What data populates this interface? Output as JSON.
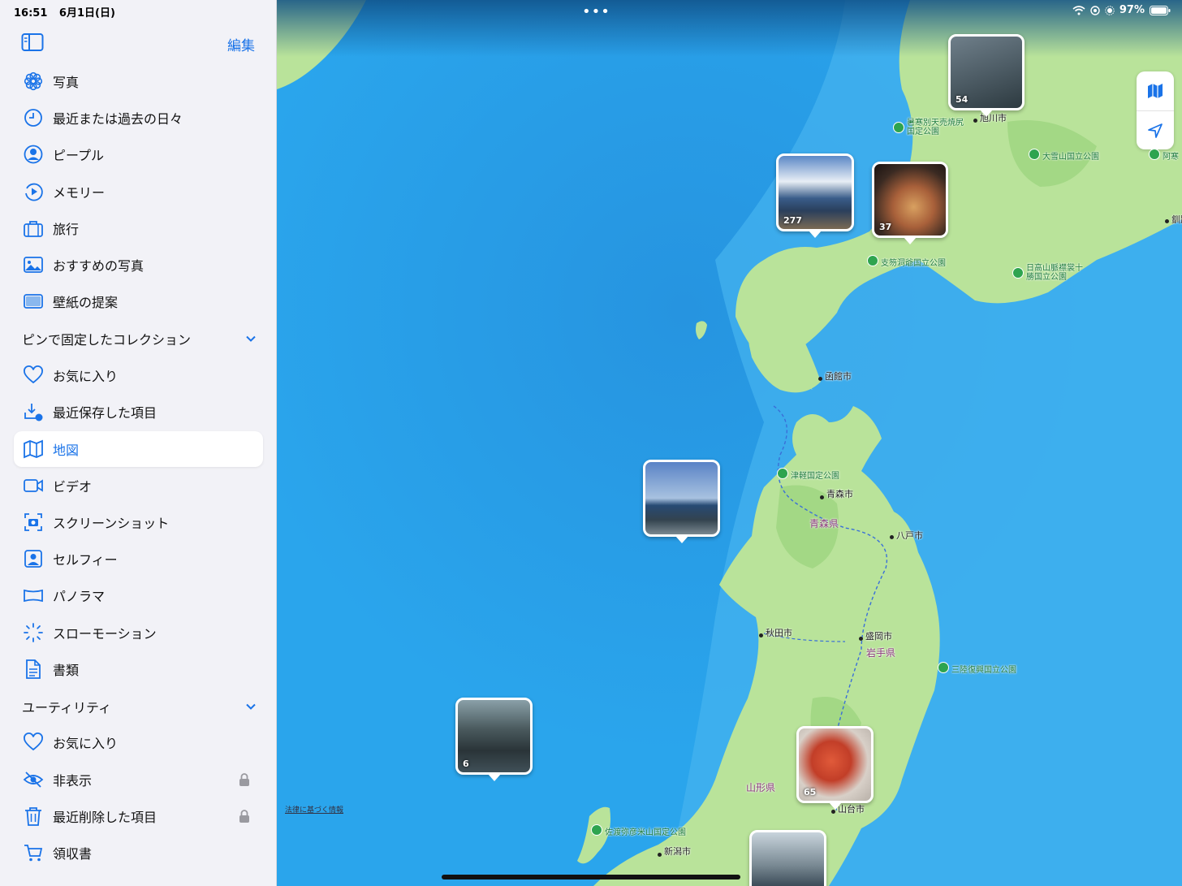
{
  "status": {
    "time": "16:51",
    "date": "6月1日(日)",
    "battery": "97%"
  },
  "sidebar": {
    "edit_label": "編集",
    "items": [
      {
        "label": "写真",
        "icon": "flower-icon"
      },
      {
        "label": "最近または過去の日々",
        "icon": "clock-icon"
      },
      {
        "label": "ピープル",
        "icon": "person-circle-icon"
      },
      {
        "label": "メモリー",
        "icon": "memories-play-icon"
      },
      {
        "label": "旅行",
        "icon": "suitcase-icon"
      },
      {
        "label": "おすすめの写真",
        "icon": "photo-icon"
      },
      {
        "label": "壁紙の提案",
        "icon": "wallpaper-icon"
      }
    ],
    "pinned_header": "ピンで固定したコレクション",
    "pinned": [
      {
        "label": "お気に入り",
        "icon": "heart-icon"
      },
      {
        "label": "最近保存した項目",
        "icon": "download-icon"
      },
      {
        "label": "地図",
        "icon": "map-icon",
        "active": true
      },
      {
        "label": "ビデオ",
        "icon": "video-icon"
      },
      {
        "label": "スクリーンショット",
        "icon": "screenshot-icon"
      },
      {
        "label": "セルフィー",
        "icon": "selfie-icon"
      },
      {
        "label": "パノラマ",
        "icon": "panorama-icon"
      },
      {
        "label": "スローモーション",
        "icon": "slowmo-icon"
      },
      {
        "label": "書類",
        "icon": "document-icon"
      }
    ],
    "utility_header": "ユーティリティ",
    "utilities": [
      {
        "label": "お気に入り",
        "icon": "heart-icon"
      },
      {
        "label": "非表示",
        "icon": "eye-slash-icon",
        "locked": true
      },
      {
        "label": "最近削除した項目",
        "icon": "trash-icon",
        "locked": true
      },
      {
        "label": "領収書",
        "icon": "cart-icon"
      }
    ]
  },
  "map": {
    "legal_link": "法律に基づく情報",
    "cities": [
      "旭川市",
      "函館市",
      "青森市",
      "八戸市",
      "秋田市",
      "盛岡市",
      "山台市",
      "新潟市",
      "釧路"
    ],
    "prefectures": [
      "青森県",
      "岩手県",
      "山形県"
    ],
    "parks": [
      "暑寒別天売焼尻国定公園",
      "大雪山国立公園",
      "阿寒",
      "支笏洞爺国立公園",
      "日高山脈襟裳十勝国立公園",
      "津軽国定公園",
      "三陸復興国立公園",
      "佐渡弥彦米山国定公園"
    ],
    "photo_counts": [
      "54",
      "277",
      "37",
      "6",
      "65"
    ]
  }
}
